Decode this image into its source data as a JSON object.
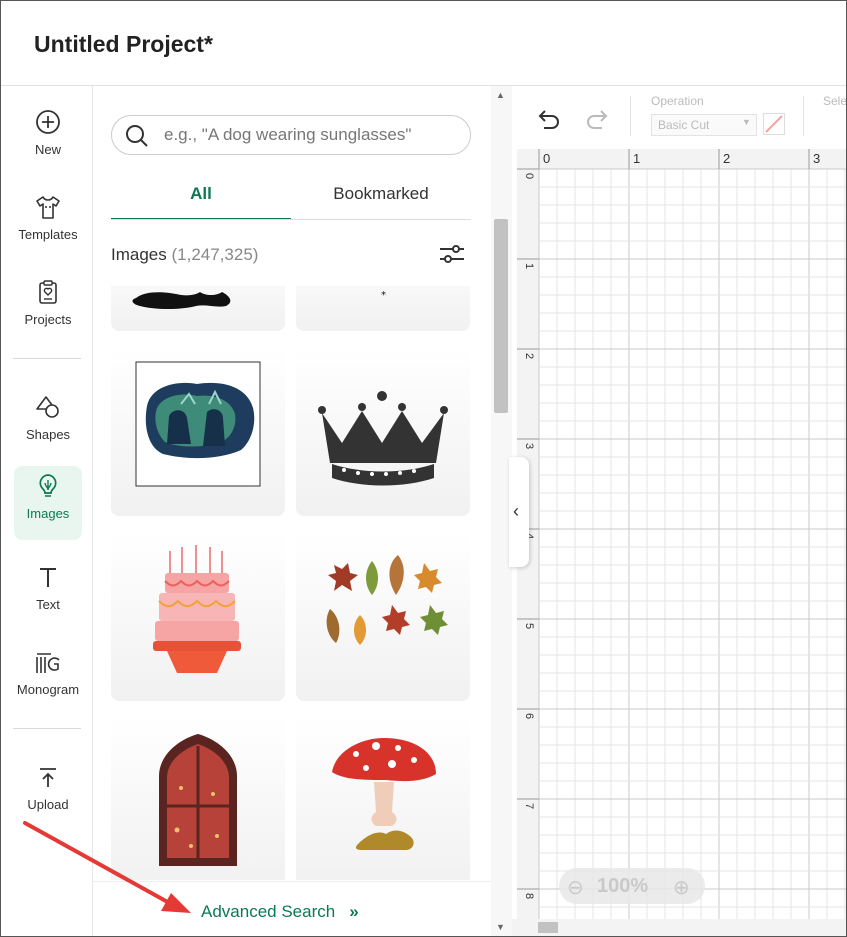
{
  "app": {
    "title": "Untitled Project*"
  },
  "nav": {
    "items": [
      {
        "label": "New",
        "icon": "plus-circle-icon"
      },
      {
        "label": "Templates",
        "icon": "tshirt-icon"
      },
      {
        "label": "Projects",
        "icon": "clipboard-icon"
      },
      {
        "label": "Shapes",
        "icon": "shapes-icon"
      },
      {
        "label": "Images",
        "icon": "lightbulb-icon",
        "active": true
      },
      {
        "label": "Text",
        "icon": "text-icon"
      },
      {
        "label": "Monogram",
        "icon": "monogram-icon"
      },
      {
        "label": "Upload",
        "icon": "upload-icon"
      }
    ]
  },
  "panel": {
    "search_placeholder": "e.g., \"A dog wearing sunglasses\"",
    "tabs": [
      {
        "label": "All",
        "active": true
      },
      {
        "label": "Bookmarked",
        "active": false
      }
    ],
    "images_label": "Images",
    "images_count": "(1,247,325)",
    "cards": [
      "dark-silhouette",
      "small-star",
      "couple-scene",
      "crown",
      "birthday-cake",
      "autumn-leaves",
      "stained-glass-window",
      "mushroom"
    ],
    "advanced_search": "Advanced Search",
    "advanced_chevron": "»"
  },
  "toolbar": {
    "operation_label": "Operation",
    "operation_value": "Basic Cut",
    "select_label": "Sele"
  },
  "ruler": {
    "top": [
      "0",
      "1",
      "2",
      "3"
    ],
    "left": [
      "0",
      "1",
      "2",
      "3",
      "4",
      "5",
      "6",
      "7",
      "8"
    ]
  },
  "zoom": {
    "minus": "⊖",
    "value": "100%",
    "plus": "⊕"
  }
}
